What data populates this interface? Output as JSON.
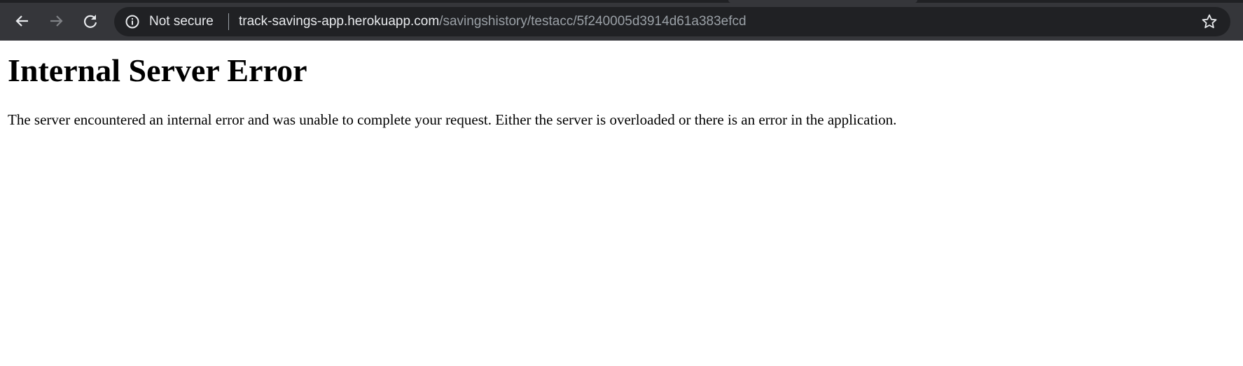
{
  "browser": {
    "security_label": "Not secure",
    "url_host": "track-savings-app.herokuapp.com",
    "url_path": "/savingshistory/testacc/5f240005d3914d61a383efcd",
    "icons": [
      "back-arrow-icon",
      "forward-arrow-icon",
      "reload-icon",
      "info-icon",
      "star-icon"
    ]
  },
  "page": {
    "title": "Internal Server Error",
    "message": "The server encountered an internal error and was unable to complete your request. Either the server is overloaded or there is an error in the application."
  }
}
